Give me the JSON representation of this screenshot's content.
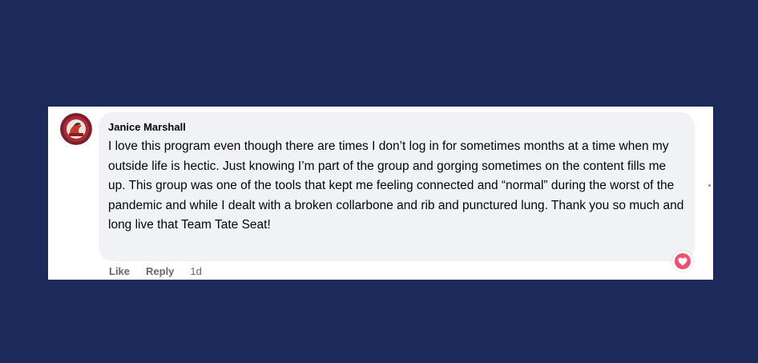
{
  "comment": {
    "author": "Janice Marshall",
    "text": "I love this program even though there are times I don’t log in for sometimes months at a time when my outside life is hectic. Just knowing I’m part of the group and gorging sometimes on the content fills me up. This group was one of the tools that kept me feeling connected and “normal” during the worst of the pandemic and while I dealt with a broken collarbone and rib and punctured lung. Thank you so much and long live that Team Tate Seat!",
    "avatar_icon": "team-logo-avatar-icon",
    "reaction_icon": "heart-reaction-icon"
  },
  "actions": {
    "like_label": "Like",
    "reply_label": "Reply",
    "timestamp": "1d"
  },
  "colors": {
    "background": "#1b2a5a",
    "bubble": "#f0f2f5",
    "heart": "#f0506e"
  }
}
